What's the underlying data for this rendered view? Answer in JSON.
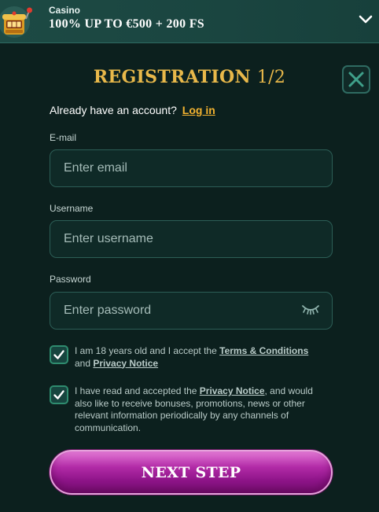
{
  "promo": {
    "category": "Casino",
    "offer": "100% UP TO €500 + 200 FS",
    "icon": "slot-machine-icon",
    "expand_icon": "chevron-down-icon"
  },
  "registration": {
    "title": "REGISTRATION",
    "step": "1/2",
    "close_icon": "close-icon",
    "account_prompt": "Already have an account?",
    "login_link": "Log in",
    "email": {
      "label": "E-mail",
      "placeholder": "Enter email",
      "value": ""
    },
    "username": {
      "label": "Username",
      "placeholder": "Enter username",
      "value": ""
    },
    "password": {
      "label": "Password",
      "placeholder": "Enter password",
      "value": "",
      "visibility_icon": "eye-closed-icon"
    },
    "consent_age": {
      "checked": true,
      "text_1": "I am 18 years old and I accept the",
      "terms_link": "Terms & Conditions",
      "text_2": "and",
      "privacy_link": "Privacy Notice"
    },
    "consent_marketing": {
      "checked": true,
      "text_1": "I have read and accepted the",
      "privacy_link": "Privacy Notice",
      "text_2": ", and would also like to receive bonuses, promotions, news or other relevant information periodically by any channels of communication."
    },
    "next_button": "NEXT STEP"
  },
  "colors": {
    "background": "#0c201e",
    "title_gold": "#e8b84a",
    "link_orange": "#f2b230",
    "button_magenta": "#b12aa6",
    "checkbox_green": "#2f8c6f"
  }
}
